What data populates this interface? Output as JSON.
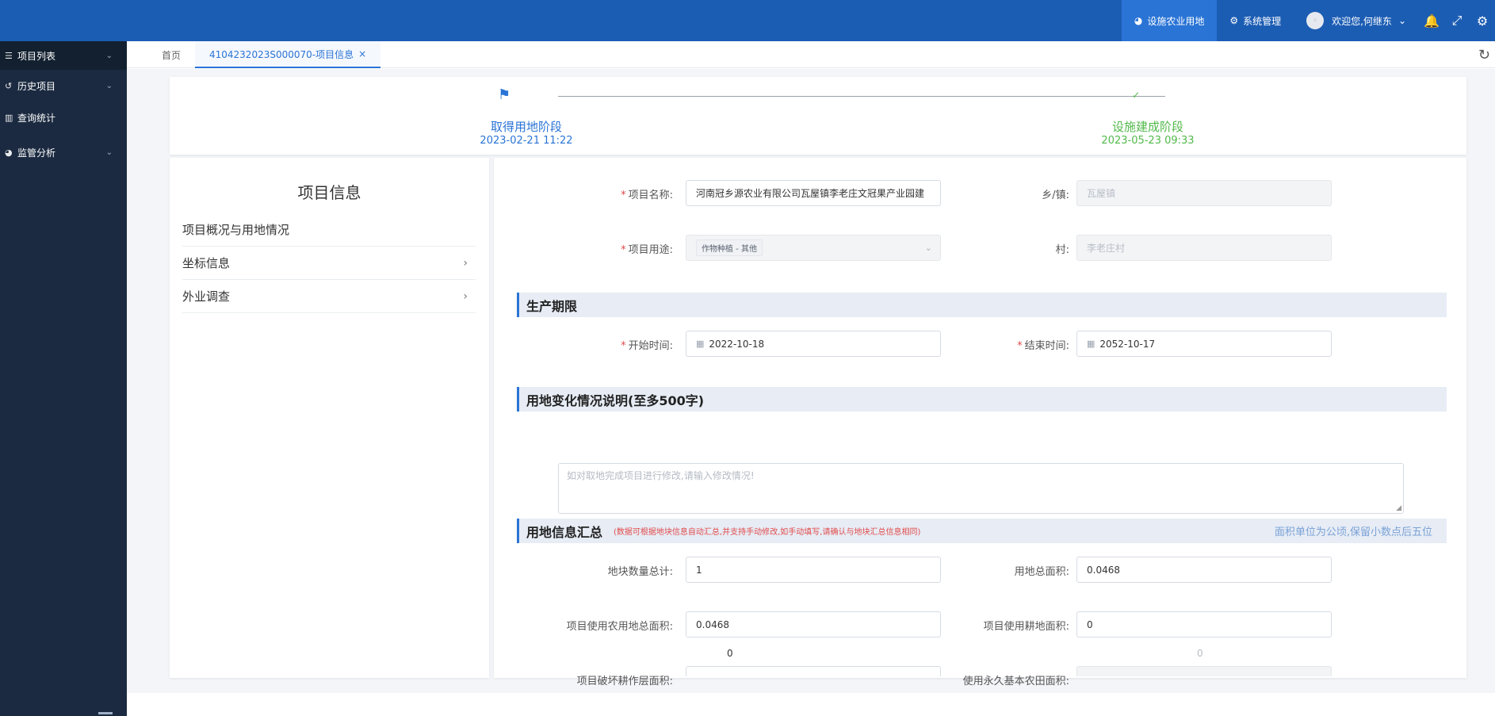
{
  "topbar": {
    "nav": [
      {
        "label": "设施农业用地",
        "icon": "pie-chart-icon",
        "active": true
      },
      {
        "label": "系统管理",
        "icon": "gears-icon",
        "active": false
      }
    ],
    "user_greeting": "欢迎您,何继东",
    "icons": [
      "bell-icon",
      "expand-icon",
      "settings-icon"
    ]
  },
  "sidebar": {
    "items": [
      {
        "label": "项目列表",
        "icon": "list-icon",
        "has_chevron": true
      },
      {
        "label": "历史项目",
        "icon": "history-icon",
        "has_chevron": true
      },
      {
        "label": "查询统计",
        "icon": "bar-chart-icon",
        "has_chevron": false
      },
      {
        "label": "监管分析",
        "icon": "pie-chart-icon",
        "has_chevron": true
      }
    ]
  },
  "tabs": {
    "home": "首页",
    "active": "4104232023S000070-项目信息",
    "close": "×"
  },
  "steps": [
    {
      "title": "取得用地阶段",
      "date": "2023-02-21 11:22",
      "status": "current"
    },
    {
      "title": "设施建成阶段",
      "date": "2023-05-23 09:33",
      "status": "done"
    }
  ],
  "left_panel": {
    "title": "项目信息",
    "items": [
      {
        "label": "项目概况与用地情况",
        "has_arrow": false
      },
      {
        "label": "坐标信息",
        "has_arrow": true
      },
      {
        "label": "外业调查",
        "has_arrow": true
      }
    ]
  },
  "form": {
    "project_name": {
      "label": "项目名称:",
      "value": "河南冠乡源农业有限公司瓦屋镇李老庄文冠果产业园建",
      "required": true
    },
    "township": {
      "label": "乡/镇:",
      "value": "瓦屋镇"
    },
    "project_use": {
      "label": "项目用途:",
      "value": "作物种植 - 其他",
      "required": true
    },
    "village": {
      "label": "村:",
      "value": "李老庄村"
    },
    "section_period": "生产期限",
    "start_time": {
      "label": "开始时间:",
      "value": "2022-10-18",
      "required": true
    },
    "end_time": {
      "label": "结束时间:",
      "value": "2052-10-17",
      "required": true
    },
    "section_change": "用地变化情况说明(至多500字)",
    "change_placeholder": "如对取地完成项目进行修改,请输入修改情况!",
    "section_summary": "用地信息汇总",
    "summary_note": "(数据可根据地块信息自动汇总,并支持手动修改,如手动填写,请确认与地块汇总信息相同)",
    "summary_unit": "面积单位为公顷,保留小数点后五位",
    "plot_count": {
      "label": "地块数量总计:",
      "value": "1"
    },
    "total_area": {
      "label": "用地总面积:",
      "value": "0.0468"
    },
    "agri_area": {
      "label": "项目使用农用地总面积:",
      "value": "0.0468"
    },
    "cultivated_area": {
      "label": "项目使用耕地面积:",
      "value": "0"
    },
    "damaged_area": {
      "label": "项目破坏耕作层面积:",
      "value": "0"
    },
    "permanent_area": {
      "label": "使用永久基本农田面积:",
      "value": "0"
    }
  },
  "colors": {
    "topbar": "#1c5db4",
    "sidebar": "#1b2a40",
    "accent": "#2a74d6",
    "success": "#52b94a",
    "required": "#e14b4b"
  }
}
